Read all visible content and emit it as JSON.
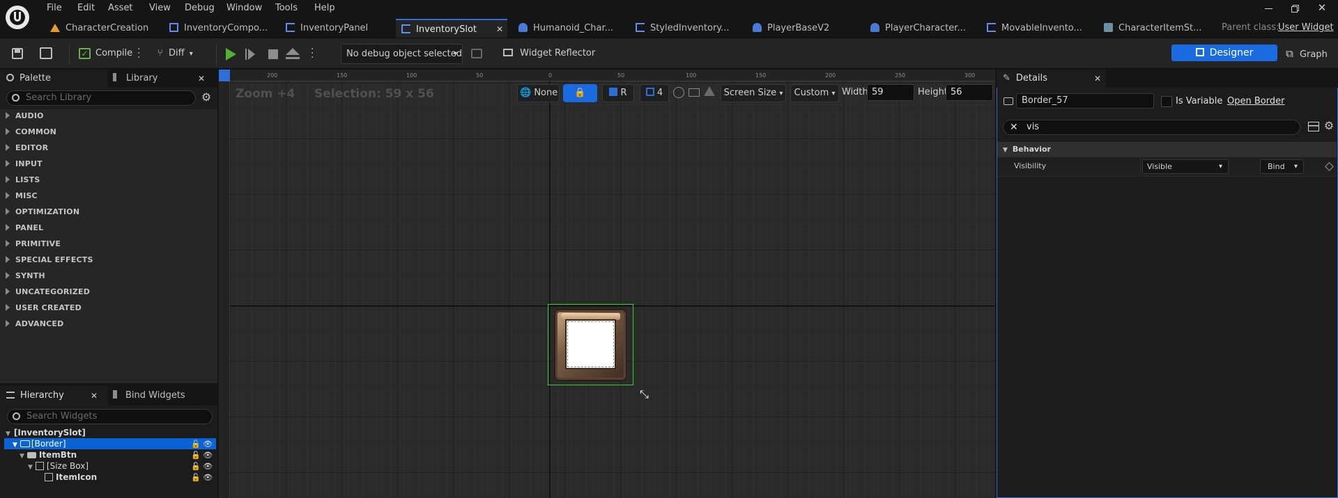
{
  "menu": {
    "file": "File",
    "edit": "Edit",
    "asset": "Asset",
    "view": "View",
    "debug": "Debug",
    "window": "Window",
    "tools": "Tools",
    "help": "Help"
  },
  "tabs": [
    {
      "label": "CharacterCreation"
    },
    {
      "label": "InventoryCompo..."
    },
    {
      "label": "InventoryPanel"
    },
    {
      "label": "InventorySlot"
    },
    {
      "label": "Humanoid_Char..."
    },
    {
      "label": "StyledInventory..."
    },
    {
      "label": "PlayerBaseV2"
    },
    {
      "label": "PlayerCharacter..."
    },
    {
      "label": "MovableInvento..."
    },
    {
      "label": "CharacterItemSt..."
    }
  ],
  "parent_class": {
    "label": "Parent class:",
    "value": "User Widget"
  },
  "toolbar": {
    "compile": "Compile",
    "diff": "Diff",
    "debug_object": "No debug object selected",
    "widget_reflector": "Widget Reflector",
    "designer": "Designer",
    "graph": "Graph"
  },
  "palette": {
    "tab_palette": "Palette",
    "tab_library": "Library",
    "search_placeholder": "Search Library",
    "categories": [
      "AUDIO",
      "COMMON",
      "EDITOR",
      "INPUT",
      "LISTS",
      "MISC",
      "OPTIMIZATION",
      "PANEL",
      "PRIMITIVE",
      "SPECIAL EFFECTS",
      "SYNTH",
      "UNCATEGORIZED",
      "USER CREATED",
      "ADVANCED"
    ]
  },
  "hierarchy": {
    "tab_hierarchy": "Hierarchy",
    "tab_bind": "Bind Widgets",
    "search_placeholder": "Search Widgets",
    "items": [
      {
        "label": "[InventorySlot]"
      },
      {
        "label": "[Border]"
      },
      {
        "label": "ItemBtn"
      },
      {
        "label": "[Size Box]"
      },
      {
        "label": "ItemIcon"
      }
    ]
  },
  "viewport": {
    "zoom": "Zoom +4",
    "selection": "Selection: 59 x 56",
    "none": "None",
    "r": "R",
    "grid_snap": "4",
    "screen_size": "Screen Size",
    "custom": "Custom",
    "width_label": "Width",
    "width_value": "59",
    "height_label": "Height",
    "height_value": "56",
    "ruler_top": [
      "200",
      "150",
      "100",
      "50",
      "0",
      "50",
      "100",
      "150",
      "200",
      "250",
      "300"
    ]
  },
  "details": {
    "tab": "Details",
    "name_value": "Border_57",
    "is_variable": "Is Variable",
    "open_border": "Open Border",
    "search_value": "vis",
    "section": "Behavior",
    "property": "Visibility",
    "property_value": "Visible",
    "bind": "Bind"
  },
  "colors": {
    "accent": "#2d6fd6",
    "selection": "#0a63d4",
    "designer_btn": "#1a6ae0",
    "select_outline": "#31d22c",
    "play": "#52b035"
  }
}
